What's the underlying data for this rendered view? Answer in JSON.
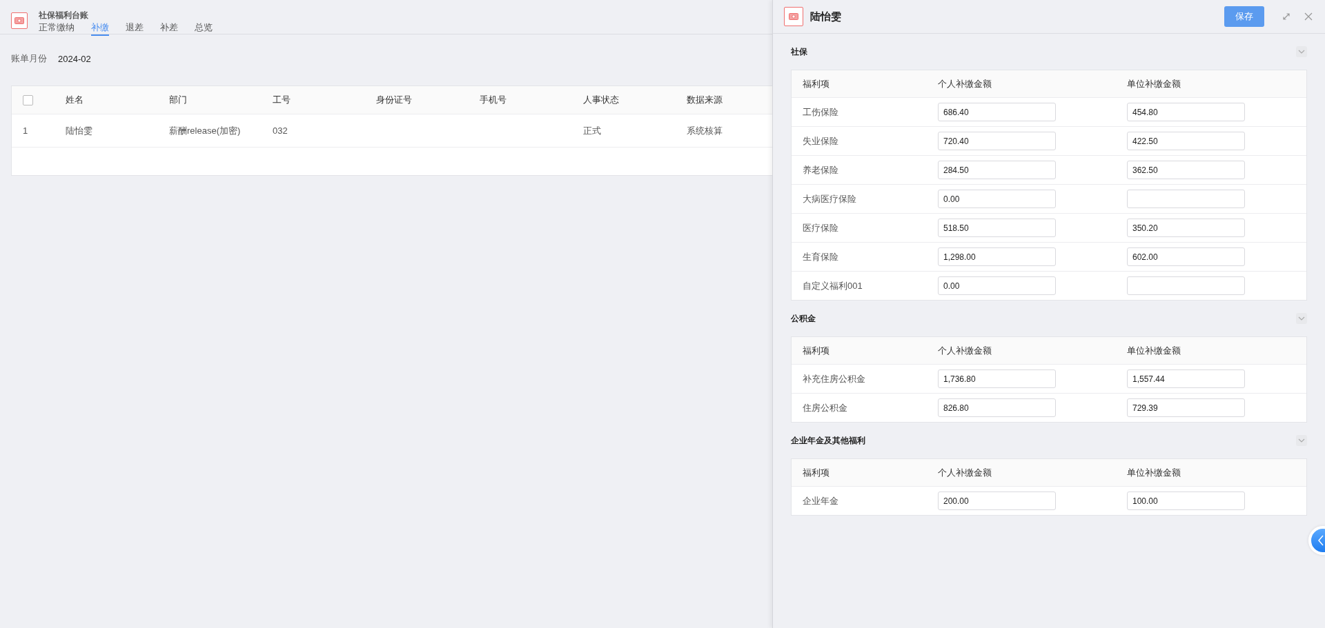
{
  "page": {
    "title": "社保福利台账",
    "tabs": [
      {
        "label": "正常缴纳",
        "selected": false
      },
      {
        "label": "补缴",
        "selected": true
      },
      {
        "label": "退差",
        "selected": false
      },
      {
        "label": "补差",
        "selected": false
      },
      {
        "label": "总览",
        "selected": false
      }
    ],
    "filter": {
      "label": "账单月份",
      "value": "2024-02"
    },
    "table": {
      "columns": [
        "姓名",
        "部门",
        "工号",
        "身份证号",
        "手机号",
        "人事状态",
        "数据来源"
      ],
      "header_checkbox": {
        "checked": false
      },
      "rows": [
        {
          "index": "1",
          "cells": [
            "陆怡雯",
            "薪酬release(加密)",
            "032",
            "",
            "",
            "正式",
            "系统核算"
          ]
        }
      ]
    }
  },
  "drawer": {
    "title": "陆怡雯",
    "save_button": "保存",
    "sections": [
      {
        "title": "社保",
        "expanded": true,
        "columns": [
          "福利项",
          "个人补缴金额",
          "单位补缴金额"
        ],
        "rows": [
          {
            "item": "工伤保险",
            "personal": "686.40",
            "company": "454.80"
          },
          {
            "item": "失业保险",
            "personal": "720.40",
            "company": "422.50"
          },
          {
            "item": "养老保险",
            "personal": "284.50",
            "company": "362.50"
          },
          {
            "item": "大病医疗保险",
            "personal": "0.00"
          },
          {
            "item": "医疗保险",
            "personal": "518.50",
            "company": "350.20"
          },
          {
            "item": "生育保险",
            "personal": "1,298.00",
            "company": "602.00"
          },
          {
            "item": "自定义福利001",
            "personal": "0.00"
          }
        ]
      },
      {
        "title": "公积金",
        "expanded": true,
        "columns": [
          "福利项",
          "个人补缴金额",
          "单位补缴金额"
        ],
        "rows": [
          {
            "item": "补充住房公积金",
            "personal": "1,736.80",
            "company": "1,557.44"
          },
          {
            "item": "住房公积金",
            "personal": "826.80",
            "company": "729.39"
          }
        ]
      },
      {
        "title": "企业年金及其他福利",
        "expanded": true,
        "columns": [
          "福利项",
          "个人补缴金额",
          "单位补缴金额"
        ],
        "rows": [
          {
            "item": "企业年金",
            "personal": "200.00",
            "company": "100.00"
          }
        ]
      }
    ]
  }
}
